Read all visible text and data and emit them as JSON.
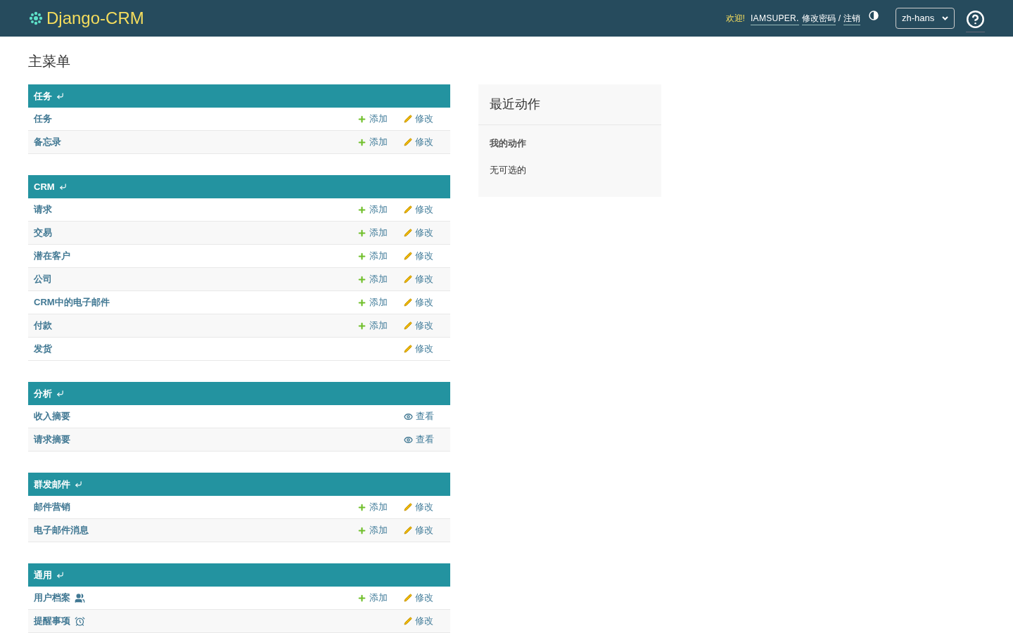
{
  "header": {
    "brand": "Django-CRM",
    "welcome": "欢迎!",
    "user": "IAMSUPER.",
    "change_password": "修改密码",
    "separator": "/",
    "logout": "注销",
    "language": "zh-hans"
  },
  "title": "主菜单",
  "sections": [
    {
      "name": "任务",
      "rows": [
        {
          "name": "任务",
          "actions": [
            {
              "kind": "add",
              "label": "添加"
            },
            {
              "kind": "change",
              "label": "修改"
            }
          ]
        },
        {
          "name": "备忘录",
          "actions": [
            {
              "kind": "add",
              "label": "添加"
            },
            {
              "kind": "change",
              "label": "修改"
            }
          ]
        }
      ]
    },
    {
      "name": "CRM",
      "rows": [
        {
          "name": "请求",
          "actions": [
            {
              "kind": "add",
              "label": "添加"
            },
            {
              "kind": "change",
              "label": "修改"
            }
          ]
        },
        {
          "name": "交易",
          "actions": [
            {
              "kind": "add",
              "label": "添加"
            },
            {
              "kind": "change",
              "label": "修改"
            }
          ]
        },
        {
          "name": "潜在客户",
          "actions": [
            {
              "kind": "add",
              "label": "添加"
            },
            {
              "kind": "change",
              "label": "修改"
            }
          ]
        },
        {
          "name": "公司",
          "actions": [
            {
              "kind": "add",
              "label": "添加"
            },
            {
              "kind": "change",
              "label": "修改"
            }
          ]
        },
        {
          "name": "CRM中的电子邮件",
          "actions": [
            {
              "kind": "add",
              "label": "添加"
            },
            {
              "kind": "change",
              "label": "修改"
            }
          ]
        },
        {
          "name": "付款",
          "actions": [
            {
              "kind": "add",
              "label": "添加"
            },
            {
              "kind": "change",
              "label": "修改"
            }
          ]
        },
        {
          "name": "发货",
          "actions": [
            {
              "kind": "change",
              "label": "修改"
            }
          ]
        }
      ]
    },
    {
      "name": "分析",
      "rows": [
        {
          "name": "收入摘要",
          "actions": [
            {
              "kind": "view",
              "label": "查看"
            }
          ]
        },
        {
          "name": "请求摘要",
          "actions": [
            {
              "kind": "view",
              "label": "查看"
            }
          ]
        }
      ]
    },
    {
      "name": "群发邮件",
      "rows": [
        {
          "name": "邮件营销",
          "actions": [
            {
              "kind": "add",
              "label": "添加"
            },
            {
              "kind": "change",
              "label": "修改"
            }
          ]
        },
        {
          "name": "电子邮件消息",
          "actions": [
            {
              "kind": "add",
              "label": "添加"
            },
            {
              "kind": "change",
              "label": "修改"
            }
          ]
        }
      ]
    },
    {
      "name": "通用",
      "rows": [
        {
          "name": "用户档案",
          "kind": "people",
          "actions": [
            {
              "kind": "add",
              "label": "添加"
            },
            {
              "kind": "change",
              "label": "修改"
            }
          ]
        },
        {
          "name": "提醒事项",
          "kind": "reminder",
          "actions": [
            {
              "kind": "change",
              "label": "修改"
            }
          ]
        }
      ]
    }
  ],
  "recent": {
    "title": "最近动作",
    "subtitle": "我的动作",
    "empty": "无可选的"
  }
}
